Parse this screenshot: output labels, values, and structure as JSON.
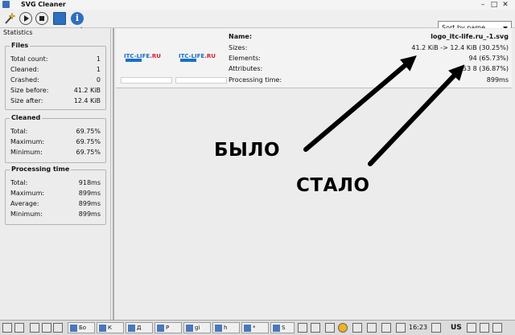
{
  "window": {
    "title": "SVG Cleaner"
  },
  "toolbar": {
    "sort_label": "Sort by name"
  },
  "statistics": {
    "title": "Statistics",
    "files": {
      "title": "Files",
      "rows": [
        {
          "label": "Total count:",
          "value": "1"
        },
        {
          "label": "Cleaned:",
          "value": "1"
        },
        {
          "label": "Crashed:",
          "value": "0"
        },
        {
          "label": "Size before:",
          "value": "41.2 KiB"
        },
        {
          "label": "Size after:",
          "value": "12.4 KiB"
        }
      ]
    },
    "cleaned": {
      "title": "Cleaned",
      "rows": [
        {
          "label": "Total:",
          "value": "69.75%"
        },
        {
          "label": "Maximum:",
          "value": "69.75%"
        },
        {
          "label": "Minimum:",
          "value": "69.75%"
        }
      ]
    },
    "processing": {
      "title": "Processing time",
      "rows": [
        {
          "label": "Total:",
          "value": "918ms"
        },
        {
          "label": "Maximum:",
          "value": "899ms"
        },
        {
          "label": "Average:",
          "value": "899ms"
        },
        {
          "label": "Minimum:",
          "value": "899ms"
        }
      ]
    }
  },
  "file": {
    "thumb_logo_main": "ITC-LIFE",
    "thumb_logo_suffix": ".RU",
    "rows": [
      {
        "label": "Name:",
        "value": "logo_itc-life.ru_-1.svg"
      },
      {
        "label": "Sizes:",
        "value": "41.2 KiB -> 12.4 KiB (30.25%)"
      },
      {
        "label": "Elements:",
        "value": "94 (65.73%)"
      },
      {
        "label": "Attributes:",
        "value": "53 8 (36.87%)"
      },
      {
        "label": "Processing time:",
        "value": "899ms"
      }
    ]
  },
  "annotations": {
    "before": "БЫЛО",
    "after": "СТАЛО"
  },
  "taskbar": {
    "items": [
      "Бо",
      "К",
      "Д",
      "P",
      "gi",
      "h",
      "*",
      "S"
    ],
    "clock": "16:23",
    "layout": "US"
  }
}
